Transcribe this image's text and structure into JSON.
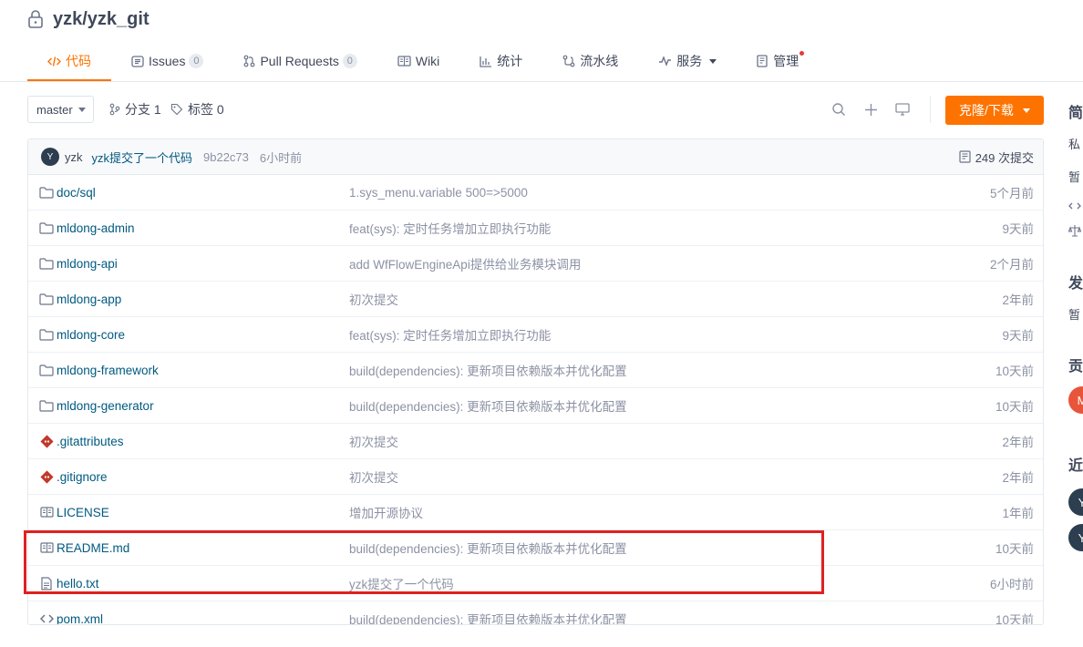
{
  "repo": {
    "title": "yzk/yzk_git"
  },
  "tabs": [
    {
      "label": "代码",
      "icon": "code-icon"
    },
    {
      "label": "Issues",
      "badge": "0",
      "icon": "issues-icon"
    },
    {
      "label": "Pull Requests",
      "badge": "0",
      "icon": "pull-request-icon"
    },
    {
      "label": "Wiki",
      "icon": "wiki-icon"
    },
    {
      "label": "统计",
      "icon": "stats-icon"
    },
    {
      "label": "流水线",
      "icon": "pipeline-icon"
    },
    {
      "label": "服务",
      "icon": "service-icon"
    },
    {
      "label": "管理",
      "icon": "manage-icon"
    }
  ],
  "toolbar": {
    "branch": "master",
    "branches_label": "分支 1",
    "tags_label": "标签 0",
    "clone_label": "克隆/下载"
  },
  "commit": {
    "avatar": "Y",
    "author": "yzk",
    "message": "yzk提交了一个代码",
    "hash": "9b22c73",
    "time": "6小时前",
    "count": "249 次提交"
  },
  "files": [
    {
      "name": "doc/sql",
      "type": "folder",
      "message": "1.sys_menu.variable 500=>5000",
      "time": "5个月前"
    },
    {
      "name": "mldong-admin",
      "type": "folder",
      "message": "feat(sys): 定时任务增加立即执行功能",
      "time": "9天前"
    },
    {
      "name": "mldong-api",
      "type": "folder",
      "message": "add WfFlowEngineApi提供给业务模块调用",
      "time": "2个月前"
    },
    {
      "name": "mldong-app",
      "type": "folder",
      "message": "初次提交",
      "time": "2年前"
    },
    {
      "name": "mldong-core",
      "type": "folder",
      "message": "feat(sys): 定时任务增加立即执行功能",
      "time": "9天前"
    },
    {
      "name": "mldong-framework",
      "type": "folder",
      "message": "build(dependencies): 更新项目依赖版本并优化配置",
      "time": "10天前"
    },
    {
      "name": "mldong-generator",
      "type": "folder",
      "message": "build(dependencies): 更新项目依赖版本并优化配置",
      "time": "10天前"
    },
    {
      "name": ".gitattributes",
      "type": "git",
      "message": "初次提交",
      "time": "2年前"
    },
    {
      "name": ".gitignore",
      "type": "git",
      "message": "初次提交",
      "time": "2年前"
    },
    {
      "name": "LICENSE",
      "type": "book",
      "message": "增加开源协议",
      "time": "1年前"
    },
    {
      "name": "README.md",
      "type": "book",
      "message": "build(dependencies): 更新项目依赖版本并优化配置",
      "time": "10天前"
    },
    {
      "name": "hello.txt",
      "type": "text",
      "message": "yzk提交了一个代码",
      "time": "6小时前"
    },
    {
      "name": "pom.xml",
      "type": "code",
      "message": "build(dependencies): 更新项目依赖版本并优化配置",
      "time": "10天前"
    }
  ],
  "sidebar": {
    "intro_heading": "简",
    "intro_private": "私",
    "intro_none": "暂",
    "release_heading": "发",
    "release_none": "暂",
    "contrib_heading": "贡",
    "contrib_avatar": "M",
    "recent_heading": "近",
    "recent_avatars": [
      "Y",
      "Y"
    ]
  },
  "colors": {
    "accent": "#fe7300",
    "link": "#005980",
    "highlight": "#e02020",
    "avatar_dark": "#2c3e50",
    "avatar_orange": "#e8553b"
  }
}
